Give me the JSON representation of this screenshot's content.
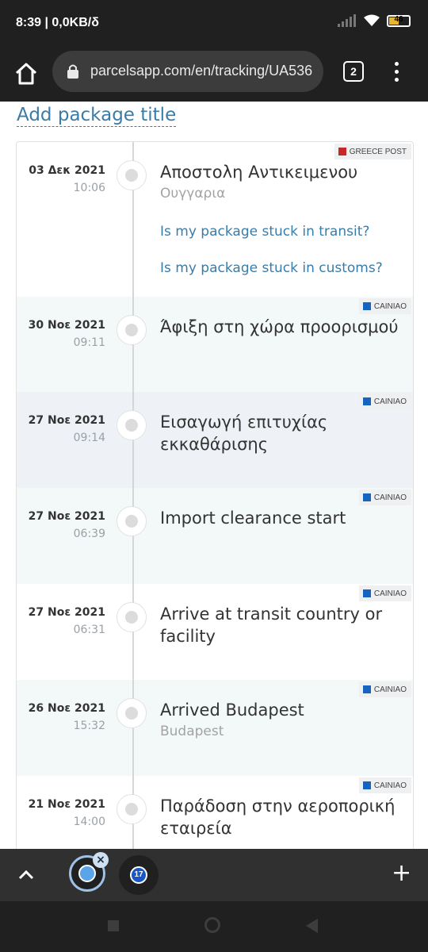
{
  "status_bar": {
    "time_speed": "8:39 | 0,0KB/δ",
    "battery": "46"
  },
  "browser": {
    "url": "parcelsapp.com/en/tracking/UA536",
    "tab_count": "2"
  },
  "page": {
    "add_title": "Add package title"
  },
  "events": [
    {
      "date": "03 Δεκ 2021",
      "time": "10:06",
      "title": "Αποστολη Αντικειμενου",
      "location": "Ουγγαρια",
      "carrier": "GREECE POST",
      "links": [
        "Is my package stuck in transit?",
        "Is my package stuck in customs?"
      ]
    },
    {
      "date": "30 Νοε 2021",
      "time": "09:11",
      "title": "Άφιξη στη χώρα προορισμού",
      "carrier": "CAINIAO"
    },
    {
      "date": "27 Νοε 2021",
      "time": "09:14",
      "title": "Εισαγωγή επιτυχίας εκκαθάρισης",
      "carrier": "CAINIAO"
    },
    {
      "date": "27 Νοε 2021",
      "time": "06:39",
      "title": "Import clearance start",
      "carrier": "CAINIAO"
    },
    {
      "date": "27 Νοε 2021",
      "time": "06:31",
      "title": "Arrive at transit country or facility",
      "carrier": "CAINIAO"
    },
    {
      "date": "26 Νοε 2021",
      "time": "15:32",
      "title": "Arrived Budapest",
      "location": "Budapest",
      "carrier": "CAINIAO"
    },
    {
      "date": "21 Νοε 2021",
      "time": "14:00",
      "title": "Παράδοση στην αεροπορική εταιρεία",
      "carrier": "CAINIAO"
    }
  ],
  "bottom_bar": {
    "tab2_badge": "17",
    "add_label": "+",
    "close_label": "×"
  },
  "colors": {
    "accent": "#3a7ca8",
    "row_shade": "#f3f8f8",
    "row_shade_alt": "#eef2f7",
    "greece_post": "#c62828",
    "cainiao": "#1565c0"
  }
}
